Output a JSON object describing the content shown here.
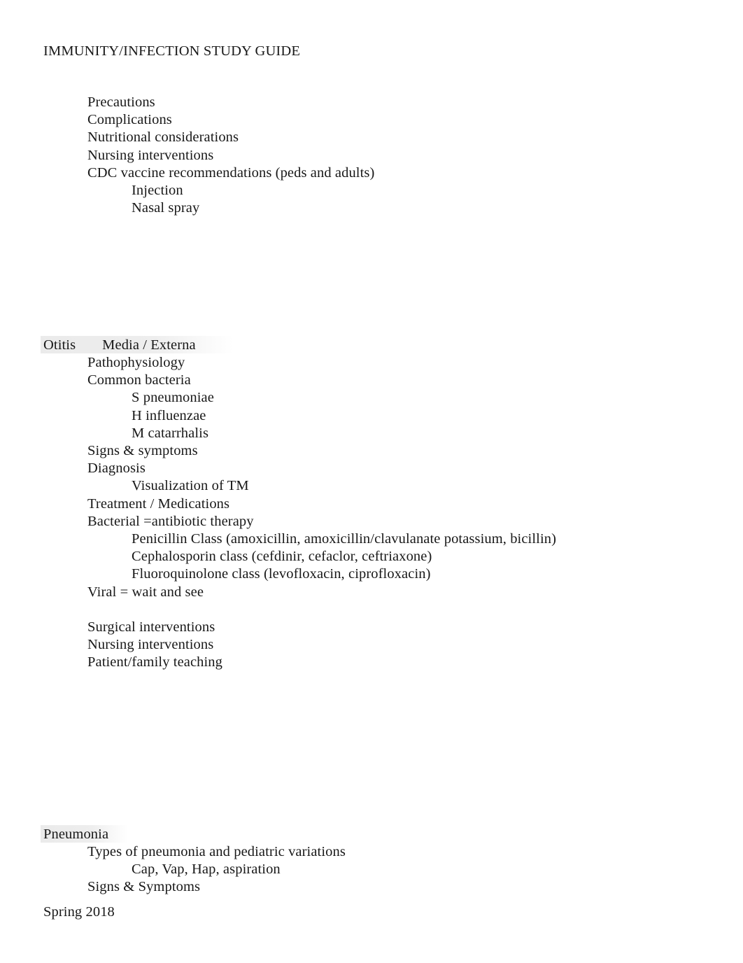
{
  "document": {
    "title": "IMMUNITY/INFECTION STUDY GUIDE",
    "footer": "Spring 2018",
    "background_color": "#ffffff",
    "text_color": "#181818",
    "highlight_color": "#dedede"
  },
  "intro_block": {
    "items": [
      {
        "text": "Precautions",
        "indent": 1
      },
      {
        "text": "Complications",
        "indent": 1
      },
      {
        "text": "Nutritional considerations",
        "indent": 1
      },
      {
        "text": "Nursing interventions",
        "indent": 1
      },
      {
        "text": "CDC vaccine recommendations (peds and adults)",
        "indent": 1
      },
      {
        "text": "Injection",
        "indent": 2
      },
      {
        "text": "Nasal spray",
        "indent": 2
      }
    ]
  },
  "otitis_section": {
    "heading_part1": "Otitis",
    "heading_part2": "Media / Externa",
    "highlighted": true,
    "items": [
      {
        "text": "Pathophysiology",
        "indent": 1
      },
      {
        "text": "Common bacteria",
        "indent": 1
      },
      {
        "text": "S pneumoniae",
        "indent": 2
      },
      {
        "text": "H influenzae",
        "indent": 2
      },
      {
        "text": "M catarrhalis",
        "indent": 2
      },
      {
        "text": "Signs & symptoms",
        "indent": 1
      },
      {
        "text": "Diagnosis",
        "indent": 1
      },
      {
        "text": "Visualization of TM",
        "indent": 2
      },
      {
        "text": "Treatment / Medications",
        "indent": 1
      },
      {
        "text": "Bacterial =antibiotic therapy",
        "indent": 1
      },
      {
        "text": "Penicillin Class (amoxicillin, amoxicillin/clavulanate potassium, bicillin)",
        "indent": 2
      },
      {
        "text": "Cephalosporin class (cefdinir, cefaclor, ceftriaxone)",
        "indent": 2
      },
      {
        "text": "Fluoroquinolone class (levofloxacin, ciprofloxacin)",
        "indent": 2
      },
      {
        "text": "Viral = wait and see",
        "indent": 1
      },
      {
        "text": "",
        "indent": 1
      },
      {
        "text": "Surgical interventions",
        "indent": 1
      },
      {
        "text": "Nursing interventions",
        "indent": 1
      },
      {
        "text": "Patient/family teaching",
        "indent": 1
      }
    ]
  },
  "pneumonia_section": {
    "heading": "Pneumonia",
    "highlighted": true,
    "items": [
      {
        "text": "Types of pneumonia and pediatric variations",
        "indent": 1
      },
      {
        "text": "Cap, Vap, Hap, aspiration",
        "indent": 2
      },
      {
        "text": "Signs & Symptoms",
        "indent": 1
      }
    ]
  }
}
